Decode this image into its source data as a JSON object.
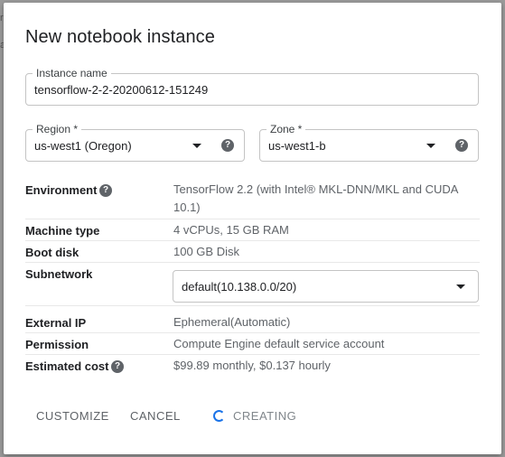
{
  "background": {
    "fragment_1": "r",
    "fragment_2": "a"
  },
  "dialog": {
    "title": "New notebook instance",
    "instance_name": {
      "label": "Instance name",
      "value": "tensorflow-2-2-20200612-151249"
    },
    "region": {
      "label": "Region *",
      "value": "us-west1 (Oregon)"
    },
    "zone": {
      "label": "Zone *",
      "value": "us-west1-b"
    },
    "environment": {
      "label": "Environment",
      "value": "TensorFlow 2.2 (with Intel® MKL-DNN/MKL and CUDA 10.1)"
    },
    "machine_type": {
      "label": "Machine type",
      "value": "4 vCPUs, 15 GB RAM"
    },
    "boot_disk": {
      "label": "Boot disk",
      "value": "100 GB Disk"
    },
    "subnetwork": {
      "label": "Subnetwork",
      "value": "default(10.138.0.0/20)"
    },
    "external_ip": {
      "label": "External IP",
      "value": "Ephemeral(Automatic)"
    },
    "permission": {
      "label": "Permission",
      "value": "Compute Engine default service account"
    },
    "estimated_cost": {
      "label": "Estimated cost",
      "value": "$99.89 monthly, $0.137 hourly"
    },
    "help_glyph": "?",
    "actions": {
      "customize": "CUSTOMIZE",
      "cancel": "CANCEL",
      "creating": "CREATING"
    }
  },
  "colors": {
    "accent": "#1a73e8",
    "secondary_text": "#5f6368",
    "border": "#c4c4c4"
  }
}
